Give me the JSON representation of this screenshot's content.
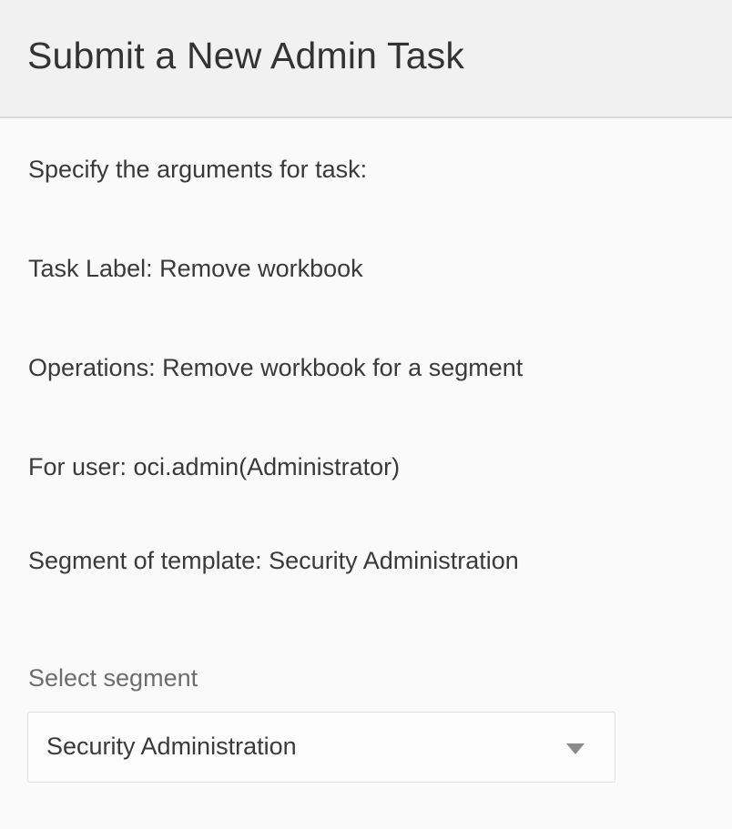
{
  "dialog": {
    "title": "Submit a New Admin Task"
  },
  "details": {
    "intro": "Specify the arguments for task:",
    "task_label": "Task Label: Remove workbook",
    "operations": "Operations: Remove workbook for a segment",
    "for_user": "For user: oci.admin(Administrator)",
    "segment_of_template": "Segment of template: Security Administration"
  },
  "segment_select": {
    "label": "Select segment",
    "selected_value": "Security Administration",
    "arrow_icon": "triangle-down-icon"
  },
  "colors": {
    "header_background": "#f1f1f1",
    "body_background": "#fafafa",
    "text": "#333333",
    "muted_text": "#6d6d6d"
  }
}
